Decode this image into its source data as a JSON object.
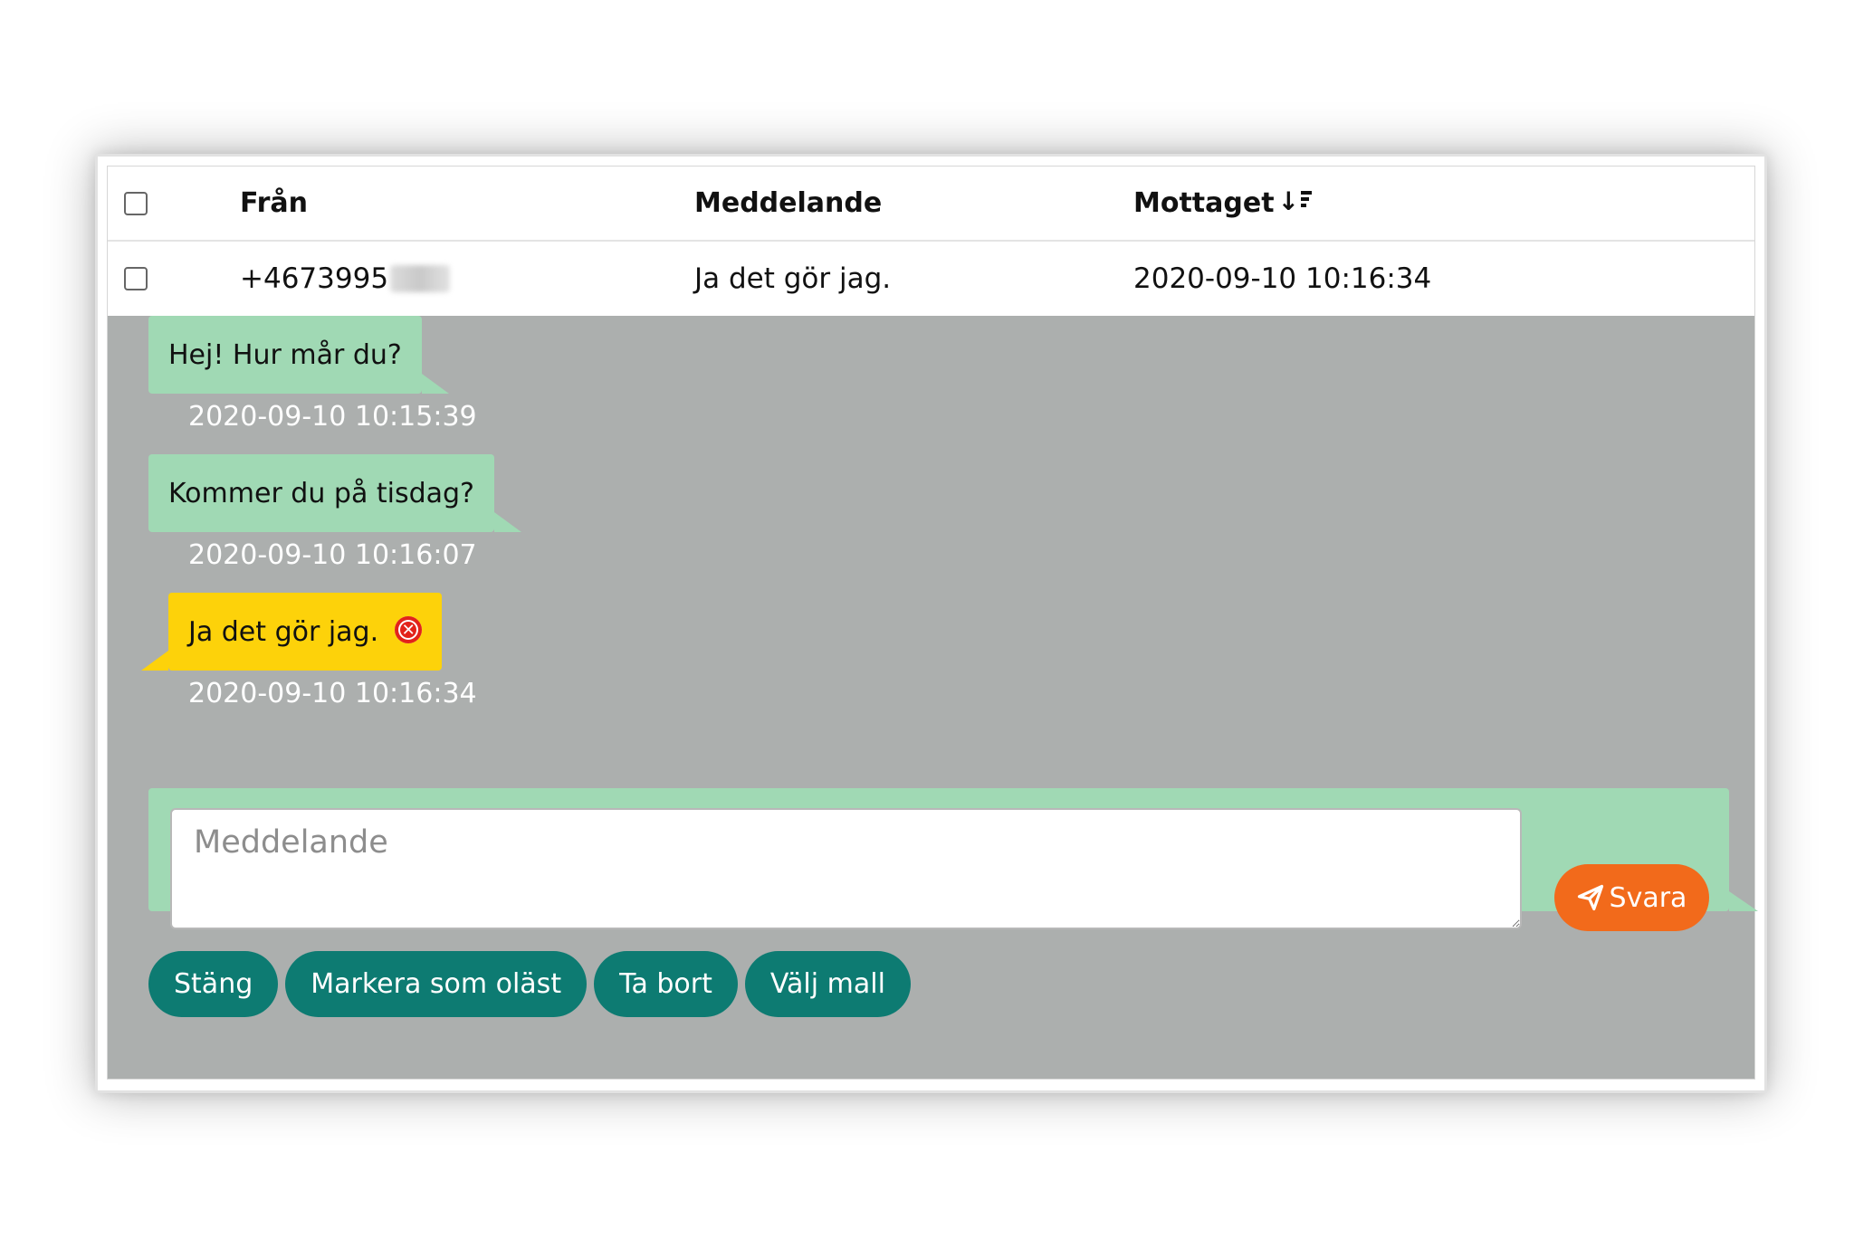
{
  "table": {
    "headers": {
      "from": "Från",
      "message": "Meddelande",
      "received": "Mottaget"
    },
    "rows": [
      {
        "from": "+4673995",
        "message": "Ja det gör jag.",
        "received": "2020-09-10 10:16:34"
      }
    ]
  },
  "conversation": [
    {
      "text": "Hej! Hur mår du?",
      "timestamp": "2020-09-10 10:15:39",
      "direction": "incoming"
    },
    {
      "text": "Kommer du på tisdag?",
      "timestamp": "2020-09-10 10:16:07",
      "direction": "incoming"
    },
    {
      "text": "Ja det gör jag.",
      "timestamp": "2020-09-10 10:16:34",
      "direction": "outgoing",
      "status_icon": "error-x-icon"
    }
  ],
  "reply": {
    "placeholder": "Meddelande",
    "send_label": "Svara"
  },
  "actions": {
    "close": "Stäng",
    "mark_unread": "Markera som oläst",
    "delete": "Ta bort",
    "choose_template": "Välj mall"
  },
  "colors": {
    "incoming_bubble": "#a0d9b4",
    "outgoing_bubble": "#fdd20a",
    "panel_bg": "#acafae",
    "send_button": "#f26a1b",
    "action_button": "#0d7b72",
    "error": "#e2231a"
  }
}
